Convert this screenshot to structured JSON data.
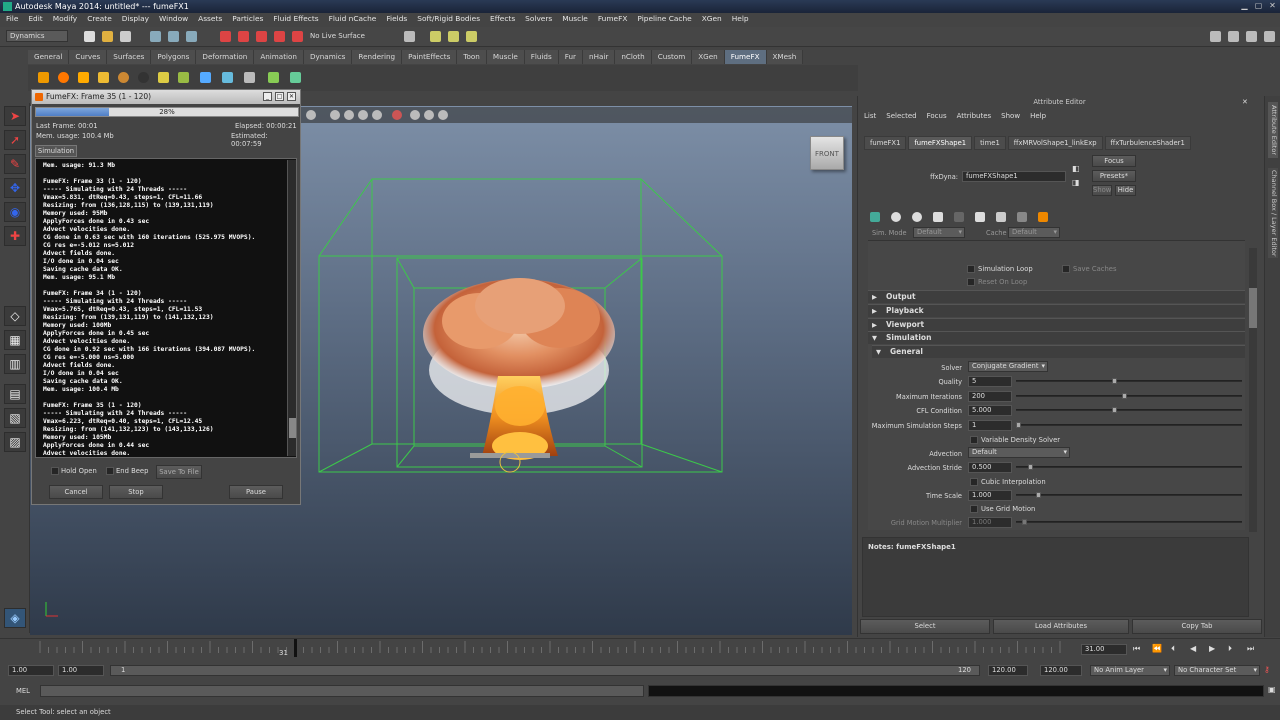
{
  "window": {
    "title": "Autodesk Maya 2014: untitled*   ---   fumeFX1"
  },
  "menubar": [
    "File",
    "Edit",
    "Modify",
    "Create",
    "Display",
    "Window",
    "Assets",
    "Particles",
    "Fluid Effects",
    "Fluid nCache",
    "Fields",
    "Soft/Rigid Bodies",
    "Effects",
    "Solvers",
    "Muscle",
    "FumeFX",
    "Pipeline Cache",
    "XGen",
    "Help"
  ],
  "status": {
    "menuset": "Dynamics",
    "live_surface": "No Live Surface"
  },
  "shelf_tabs": [
    "General",
    "Curves",
    "Surfaces",
    "Polygons",
    "Deformation",
    "Animation",
    "Dynamics",
    "Rendering",
    "PaintEffects",
    "Toon",
    "Muscle",
    "Fluids",
    "Fur",
    "nHair",
    "nCloth",
    "Custom",
    "XGen",
    "FumeFX",
    "XMesh"
  ],
  "shelf_active": "FumeFX",
  "viewport": {
    "view_cube": "FRONT"
  },
  "sim_dialog": {
    "title": "FumeFX: Frame 35 (1 - 120)",
    "progress": 0.28,
    "progress_label": "28%",
    "last_frame": "Last Frame: 00:01",
    "elapsed": "Elapsed: 00:00:21",
    "mem_usage": "Mem. usage: 100.4 Mb",
    "estimated": "Estimated: 00:07:59",
    "tab": "Simulation",
    "log": "Mem. usage: 91.3 Mb\n\nFumeFX: Frame 33 (1 - 120)\n----- Simulating with 24 Threads -----\nVmax=5.831, dtReq=0.43, steps=1, CFL=11.66\nResizing: from (136,128,115) to (139,131,119)\nMemory used: 95Mb\nApplyForces done in 0.43 sec\nAdvect velocities done.\nCG done in 0.63 sec with 160 iterations (525.975 MVOPS).\nCG res e=-5.012 ns=5.012\nAdvect fields done.\nI/O done in 0.04 sec\nSaving cache data OK.\nMem. usage: 95.1 Mb\n\nFumeFX: Frame 34 (1 - 120)\n----- Simulating with 24 Threads -----\nVmax=5.765, dtReq=0.43, steps=1, CFL=11.53\nResizing: from (139,131,119) to (141,132,123)\nMemory used: 100Mb\nApplyForces done in 0.45 sec\nAdvect velocities done.\nCG done in 0.92 sec with 166 iterations (394.087 MVOPS).\nCG res e=-5.000 ns=5.000\nAdvect fields done.\nI/O done in 0.04 sec\nSaving cache data OK.\nMem. usage: 100.4 Mb\n\nFumeFX: Frame 35 (1 - 120)\n----- Simulating with 24 Threads -----\nVmax=6.223, dtReq=0.40, steps=1, CFL=12.45\nResizing: from (141,132,123) to (143,133,126)\nMemory used: 105Mb\nApplyForces done in 0.44 sec\nAdvect velocities done.",
    "hold_open": "Hold Open",
    "end_beep": "End Beep",
    "save_to_file": "Save To File",
    "cancel": "Cancel",
    "stop": "Stop",
    "pause": "Pause"
  },
  "attr_editor": {
    "title": "Attribute Editor",
    "menu": [
      "List",
      "Selected",
      "Focus",
      "Attributes",
      "Show",
      "Help"
    ],
    "tabs": [
      "fumeFX1",
      "fumeFXShape1",
      "time1",
      "ffxMRVolShape1_linkExp",
      "ffxTurbulenceShader1"
    ],
    "active_tab": "fumeFXShape1",
    "node_label": "ffxDyna:",
    "node_name": "fumeFXShape1",
    "focus": "Focus",
    "presets": "Presets*",
    "show": "Show",
    "hide": "Hide",
    "sim_mode_label": "Sim. Mode",
    "sim_mode_value": "Default",
    "cache_label": "Cache",
    "cache_value": "Default",
    "simulation_loop": "Simulation Loop",
    "save_caches": "Save Caches",
    "reset_on_loop": "Reset On Loop",
    "sections": [
      "Output",
      "Playback",
      "Viewport",
      "Simulation",
      "General"
    ],
    "solver_label": "Solver",
    "solver_value": "Conjugate Gradient",
    "quality_label": "Quality",
    "quality_value": "5",
    "max_iter_label": "Maximum Iterations",
    "max_iter_value": "200",
    "cfl_label": "CFL Condition",
    "cfl_value": "5.000",
    "max_steps_label": "Maximum Simulation Steps",
    "max_steps_value": "1",
    "variable_density": "Variable Density Solver",
    "advection_label": "Advection",
    "advection_value": "Default",
    "adv_stride_label": "Advection Stride",
    "adv_stride_value": "0.500",
    "cubic_interp": "Cubic Interpolation",
    "time_scale_label": "Time Scale",
    "time_scale_value": "1.000",
    "use_grid_motion": "Use Grid Motion",
    "grid_motion_label": "Grid Motion Multiplier",
    "grid_motion_value": "1.000",
    "notes": "Notes: fumeFXShape1",
    "select": "Select",
    "load_attrs": "Load Attributes",
    "copy_tab": "Copy Tab"
  },
  "side_tabs": [
    "Attribute Editor",
    "Channel Box / Layer Editor"
  ],
  "timeline": {
    "current": "31",
    "frame_field": "31.00",
    "start": "1.00",
    "start2": "1.00",
    "marker": "1",
    "end_marker": "120",
    "end": "120.00",
    "end2": "120.00",
    "anim_layer": "No Anim Layer",
    "char_set": "No Character Set"
  },
  "command": {
    "label": "MEL"
  },
  "help": "Select Tool: select an object"
}
